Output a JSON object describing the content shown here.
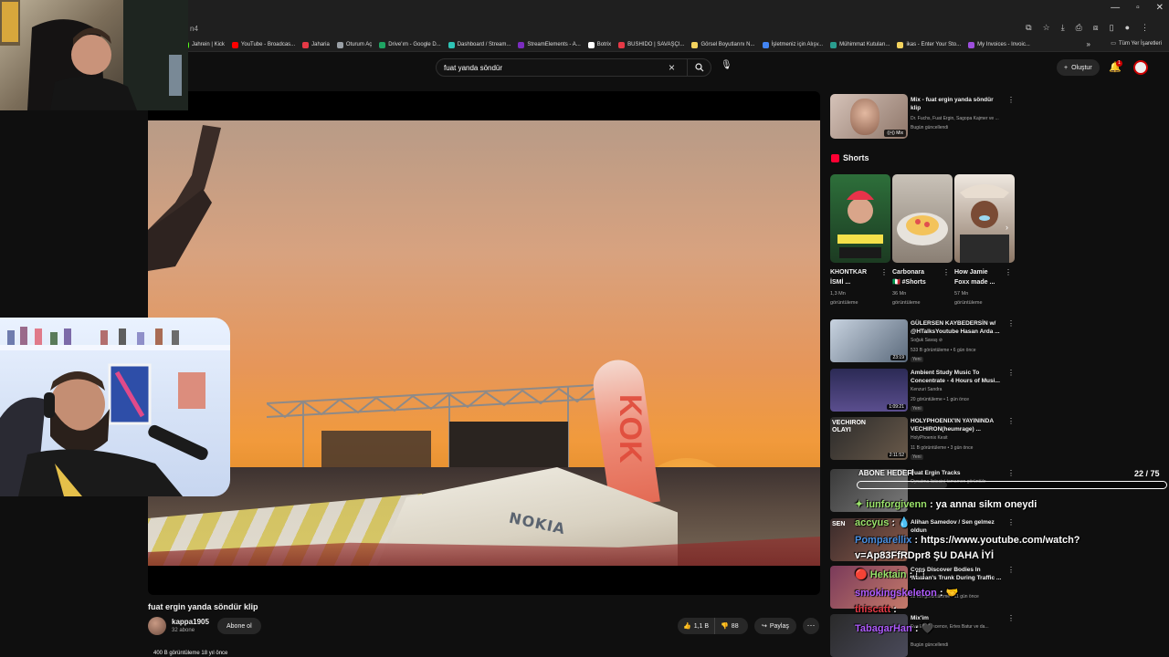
{
  "browser": {
    "address_fragment": "n4",
    "bookmarks": [
      {
        "label": "Jahrein | Kick",
        "color": "#53fc18"
      },
      {
        "label": "YouTube - Broadcas...",
        "color": "#ff0000"
      },
      {
        "label": "Jaharia",
        "color": "#e63946"
      },
      {
        "label": "Oturum Aç",
        "color": "#9aa0a6"
      },
      {
        "label": "Drive'ım - Google D...",
        "color": "#1fa463"
      },
      {
        "label": "Dashboard / Stream...",
        "color": "#2ec4b6"
      },
      {
        "label": "StreamElements - A...",
        "color": "#7b2cbf"
      },
      {
        "label": "Botrix",
        "color": "#ffffff"
      },
      {
        "label": "BUSHIDO | SAVAŞÇI...",
        "color": "#e63946"
      },
      {
        "label": "Görsel Boyutlarını N...",
        "color": "#f4d35e"
      },
      {
        "label": "İşletmeniz için Alışv...",
        "color": "#4285f4"
      },
      {
        "label": "Mühimmat Kutuları...",
        "color": "#2a9d8f"
      },
      {
        "label": "ikas - Enter Your Sto...",
        "color": "#f4d35e"
      },
      {
        "label": "My Invoices - Invoic...",
        "color": "#9d4edd"
      }
    ],
    "bookmarks_more": "»",
    "all_bookmarks": "Tüm Yer İşaretleri"
  },
  "header": {
    "search_value": "fuat yanda söndür",
    "create_label": "Oluştur",
    "notification_count": "1"
  },
  "video": {
    "title": "fuat ergin yanda söndür klip",
    "overlay_brand": "NOKIA",
    "flag_letters": "KOK",
    "channel_name": "kappa1905",
    "channel_subs": "32 abone",
    "subscribe_label": "Abone ol",
    "likes": "1,1 B",
    "dislikes": "88",
    "share_label": "Paylaş",
    "views_line": "400 B görüntüleme  18 yıl önce"
  },
  "sidebar": {
    "mix": {
      "title": "Mix - fuat ergin yanda söndür klip",
      "artists": "Dr. Fuchs, Fuat Ergin, Sagopa Kajmer ve ...",
      "updated": "Bugün güncellendi",
      "tag": "Mix"
    },
    "shorts_heading": "Shorts",
    "shorts": [
      {
        "title_1": "KHONTKAR",
        "title_2": "İSMİ ...",
        "views_1": "1,3 Mn",
        "views_2": "görüntüleme"
      },
      {
        "title_1": "Carbonara",
        "title_2": "🇮🇹 #Shorts",
        "views_1": "36 Mn",
        "views_2": "görüntüleme"
      },
      {
        "title_1": "How Jamie",
        "title_2": "Foxx made ...",
        "views_1": "57 Mn",
        "views_2": "görüntüleme"
      }
    ],
    "videos": [
      {
        "title_1": "GÜLERSEN KAYBEDERSİN w/",
        "title_2": "@HTalksYoutube Hasan Arda ...",
        "channel": "Soğuk Savaş ⊘",
        "meta": "533 B görüntüleme • 6 gün önce",
        "badge": "Yeni",
        "duration": "23:19"
      },
      {
        "title_1": "Ambient Study Music To",
        "title_2": "Concentrate - 4 Hours of Musi...",
        "channel": "Kenzuri Sandra",
        "meta": "20 görüntüleme • 1 gün önce",
        "badge": "Yeni",
        "duration": "1:09:21"
      },
      {
        "title_1": "HOLYPHOENIX'IN YAYININDA",
        "title_2": "VECHIRON(heumrage) ...",
        "channel": "HolyPhoenix Kesit",
        "meta": "11 B görüntüleme • 3 gün önce",
        "badge": "Yeni",
        "duration": "2:11:52",
        "thumb_text": "VECHIRON OLAYI"
      },
      {
        "title_1": "Fuat Ergin Tracks",
        "title_2": "",
        "channel": "Oynatma listesini tamamen görüntüle",
        "meta": "",
        "badge": "",
        "duration": ""
      },
      {
        "title_1": "Alihan Samedov / Sen gelmez",
        "title_2": "oldun",
        "channel": "",
        "meta": "",
        "badge": "",
        "duration": "",
        "thumb_text": "SEN"
      },
      {
        "title_1": "Cops Discover Bodies In",
        "title_2": "Woman's Trunk During Traffic ...",
        "channel": "",
        "meta": "22 Mn görüntüleme • 11 gün önce",
        "badge": "",
        "duration": ""
      },
      {
        "title_1": "Mix'im",
        "title_2": "",
        "channel": "Eva Evanescence, Ertes Batur ve da...",
        "meta": "Bugün güncellendi",
        "badge": "",
        "duration": ""
      }
    ]
  },
  "chat": {
    "goal_label": "ABONE HEDEFİ",
    "goal_count": "22   / 75",
    "goal_fraction": 0.29,
    "messages": [
      {
        "user": "iunforgivenn",
        "text": " : ya annaı sikm oneydi",
        "color": "#9be36b",
        "prefix": "✦ "
      },
      {
        "user": "accyus",
        "text": " : 💧",
        "color": "#9be36b",
        "prefix": ""
      },
      {
        "user": "Pomparellix",
        "text": " : https://www.youtube.com/watch?",
        "color": "#4a90e2",
        "prefix": ""
      },
      {
        "user": "",
        "text": "v=Ap83FfRDpr8 ŞU DAHA İYİ",
        "color": "#ffffff",
        "prefix": ""
      },
      {
        "user": "Hektain",
        "text": " : ⬚",
        "color": "#9be36b",
        "prefix": "🔴 "
      },
      {
        "user": "smokingskeleton",
        "text": " : 🤝",
        "color": "#b05cff",
        "prefix": ""
      },
      {
        "user": "thiscatt",
        "text": " :",
        "color": "#e63946",
        "prefix": ""
      },
      {
        "user": "TabagarHan",
        "text": " : 🖤",
        "color": "#b05cff",
        "prefix": ""
      }
    ]
  }
}
